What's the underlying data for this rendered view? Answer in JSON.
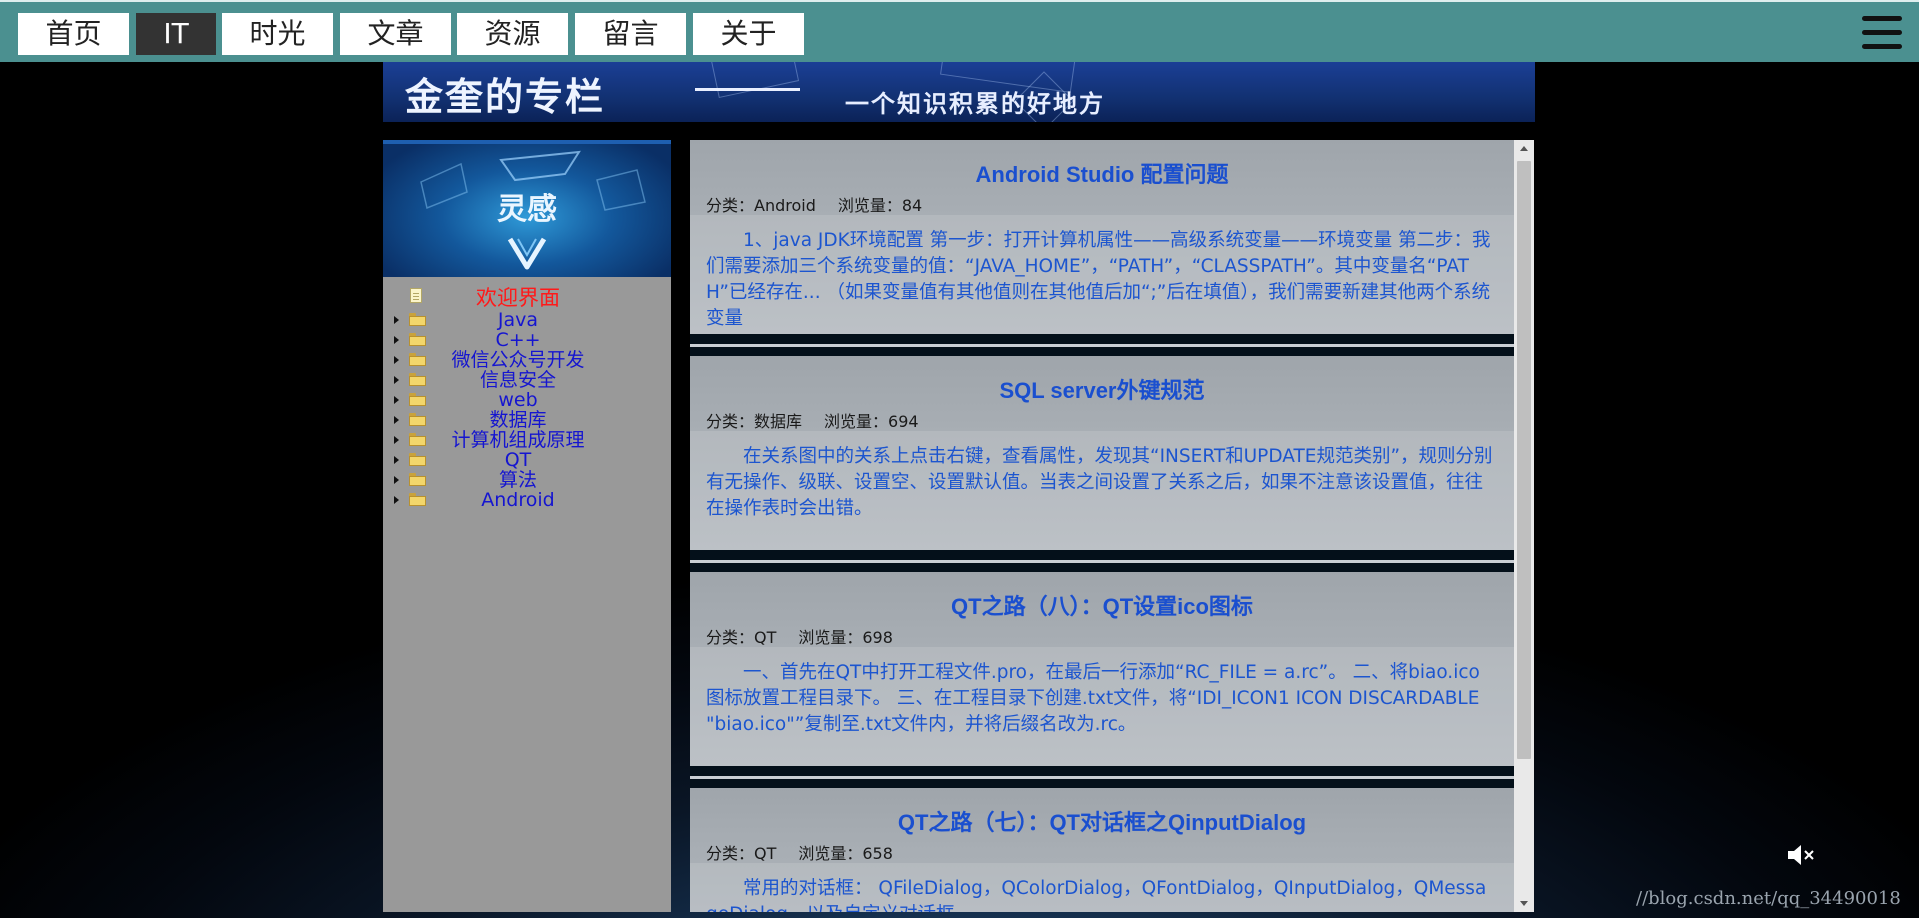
{
  "nav": {
    "items": [
      "首页",
      "IT",
      "时光",
      "文章",
      "资源",
      "留言",
      "关于"
    ],
    "active": "IT"
  },
  "banner": {
    "title": "金奎的专栏",
    "tagline": "一个知识积累的好地方"
  },
  "sidebar": {
    "title": "灵感",
    "welcome": "欢迎界面",
    "categories": [
      "Java",
      "C++",
      "微信公众号开发",
      "信息安全",
      "web",
      "数据库",
      "计算机组成原理",
      "QT",
      "算法",
      "Android"
    ]
  },
  "posts": [
    {
      "title": "Android Studio 配置问题",
      "category_label": "分类：Android",
      "views_label": "浏览量：84",
      "excerpt": "1、java JDK环境配置 第一步：打开计算机属性——高级系统变量——环境变量 第二步：我们需要添加三个系统变量的值：“JAVA_HOME”，“PATH”，“CLASSPATH”。其中变量名“PATH”已经存在... （如果变量值有其他值则在其他值后加“;”后在填值），我们需要新建其他两个系统变量"
    },
    {
      "title": "SQL server外键规范",
      "category_label": "分类：数据库",
      "views_label": "浏览量：694",
      "excerpt": "在关系图中的关系上点击右键，查看属性，发现其“INSERT和UPDATE规范类别”，规则分别有无操作、级联、设置空、设置默认值。当表之间设置了关系之后，如果不注意该设置值，往往在操作表时会出错。"
    },
    {
      "title": "QT之路（八）：QT设置ico图标",
      "category_label": "分类：QT",
      "views_label": "浏览量：698",
      "excerpt": "一、首先在QT中打开工程文件.pro，在最后一行添加“RC_FILE = a.rc”。 二、将biao.ico图标放置工程目录下。 三、在工程目录下创建.txt文件，将“IDI_ICON1 ICON DISCARDABLE \"biao.ico\"”复制至.txt文件内，并将后缀名改为.rc。"
    },
    {
      "title": "QT之路（七）：QT对话框之QinputDialog",
      "category_label": "分类：QT",
      "views_label": "浏览量：658",
      "excerpt": "常用的对话框： QFileDialog，QColorDialog，QFontDialog，QInputDialog，QMessageDialog，以及自定义对话框"
    }
  ],
  "watermark": "//blog.csdn.net/qq_34490018",
  "icons": {
    "menu": "hamburger-menu-icon",
    "sound": "speaker-muted-icon",
    "folder": "folder-icon",
    "doc": "document-icon",
    "expand": "triangle-right-icon"
  },
  "colors": {
    "nav_bg": "#4b9090",
    "nav_active_bg": "#333333",
    "link_blue": "#1a4fcf",
    "tree_blue": "#1515d0",
    "welcome_red": "#ff1a1a",
    "sidebar_bg": "#999999"
  }
}
